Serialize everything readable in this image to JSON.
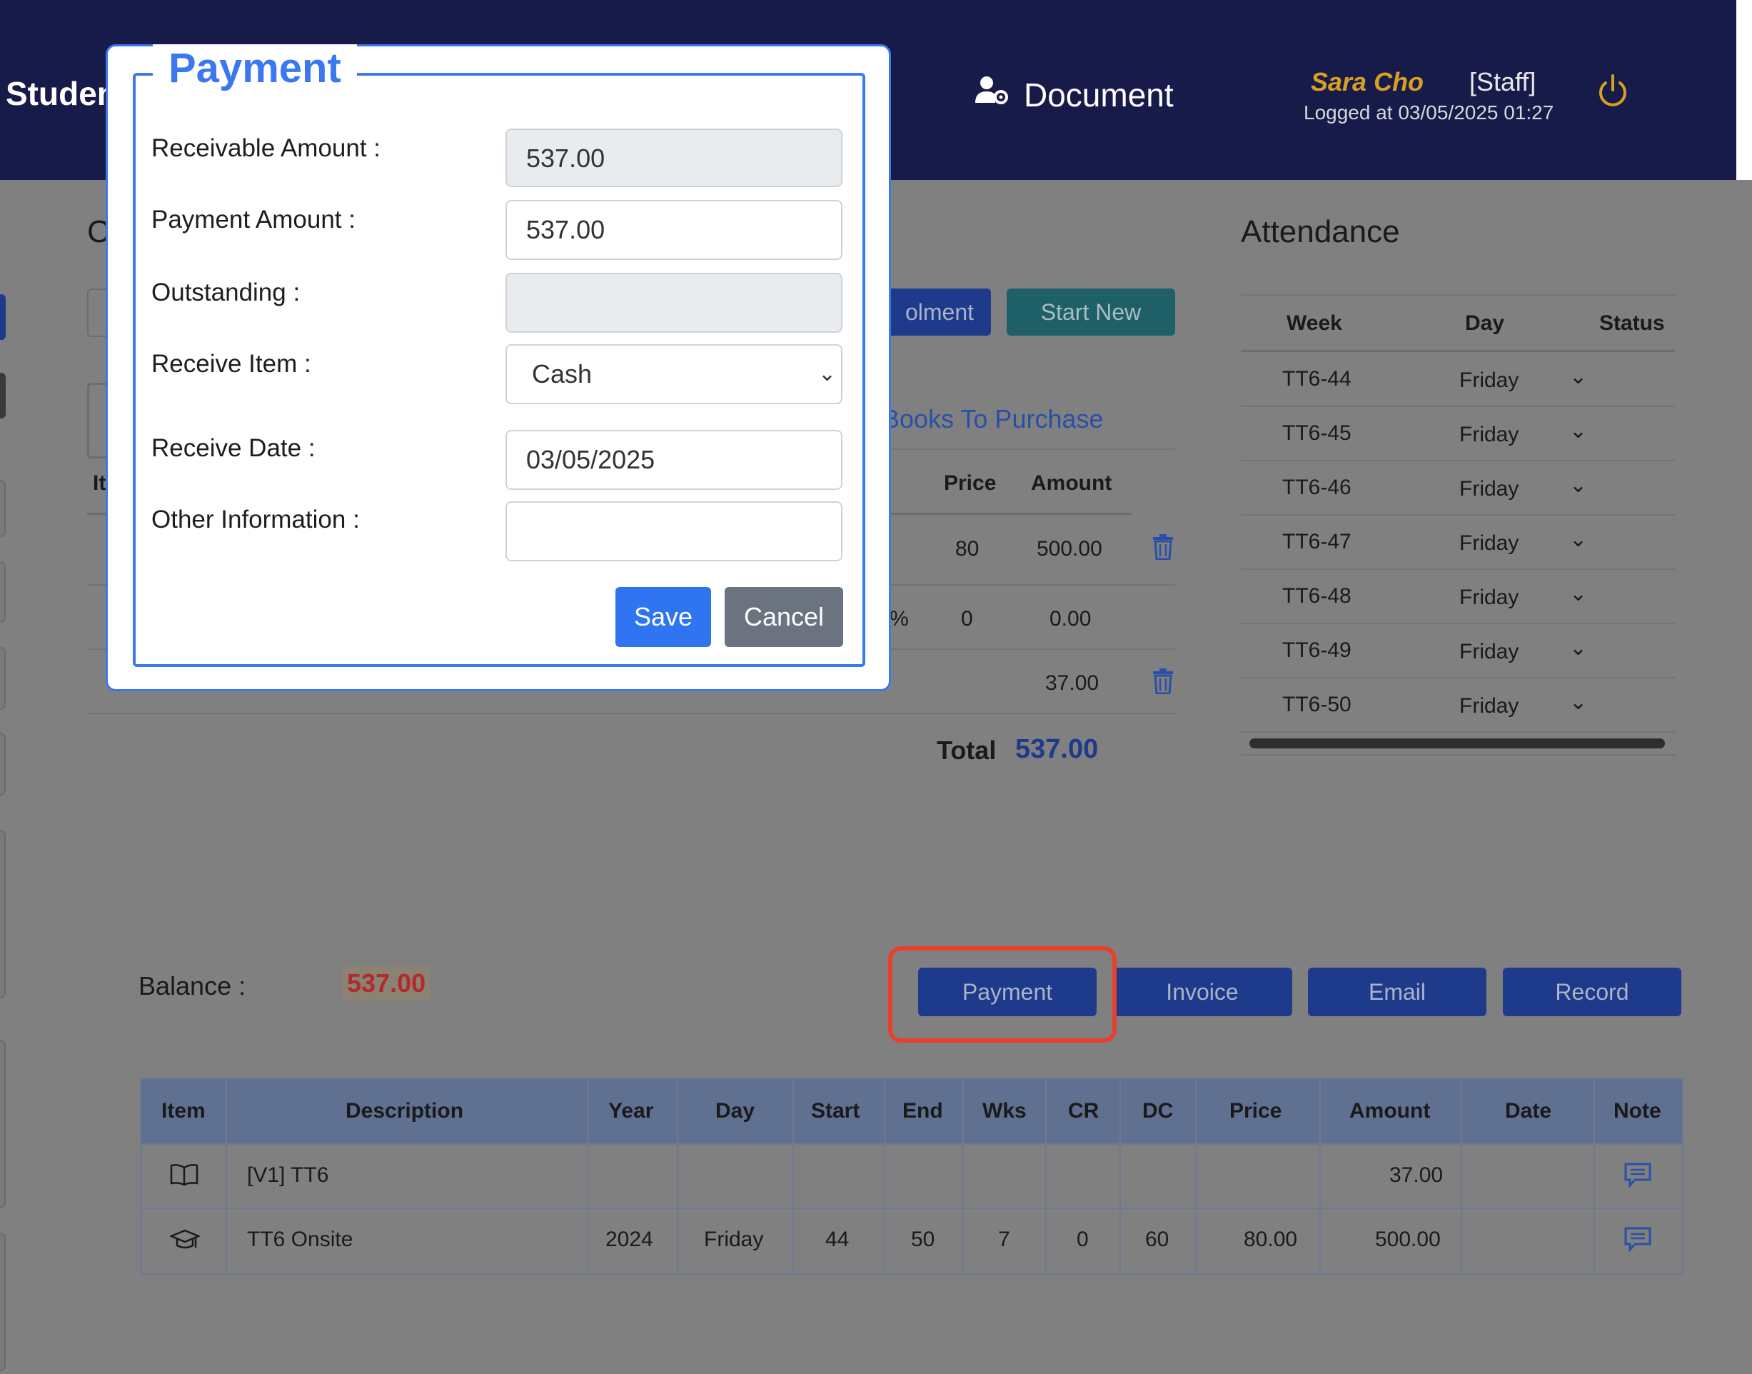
{
  "header": {
    "nav_left": "Studen",
    "nav_document": "Document",
    "user_name": "Sara Cho",
    "user_role": "[Staff]",
    "logged_at": "Logged at 03/05/2025 01:27"
  },
  "page": {
    "left_title_fragment": "C",
    "item_fragment": "It",
    "enrolment_fragment": "olment",
    "start_new": "Start New",
    "books_link": "Books To Purchase",
    "books_table": {
      "headers": [
        "Price",
        "Amount"
      ],
      "rows": [
        {
          "price": "80",
          "amount": "500.00"
        },
        {
          "pct": "%",
          "price": "0",
          "amount": "0.00"
        },
        {
          "price": "",
          "amount": "37.00"
        }
      ]
    },
    "total_label": "Total",
    "total_value": "537.00",
    "balance_label": "Balance :",
    "balance_value": "537.00"
  },
  "attendance": {
    "title": "Attendance",
    "headers": [
      "Week",
      "Day",
      "Status"
    ],
    "rows": [
      {
        "week": "TT6-44",
        "day": "Friday"
      },
      {
        "week": "TT6-45",
        "day": "Friday"
      },
      {
        "week": "TT6-46",
        "day": "Friday"
      },
      {
        "week": "TT6-47",
        "day": "Friday"
      },
      {
        "week": "TT6-48",
        "day": "Friday"
      },
      {
        "week": "TT6-49",
        "day": "Friday"
      },
      {
        "week": "TT6-50",
        "day": "Friday"
      }
    ]
  },
  "actions": {
    "payment": "Payment",
    "invoice": "Invoice",
    "email": "Email",
    "record": "Record"
  },
  "enrolment_table": {
    "headers": [
      "Item",
      "Description",
      "Year",
      "Day",
      "Start",
      "End",
      "Wks",
      "CR",
      "DC",
      "Price",
      "Amount",
      "Date",
      "Note"
    ],
    "rows": [
      {
        "icon": "book-icon",
        "description": "[V1] TT6",
        "year": "",
        "day": "",
        "start": "",
        "end": "",
        "wks": "",
        "cr": "",
        "dc": "",
        "price": "",
        "amount": "37.00",
        "date": ""
      },
      {
        "icon": "graduation-cap-icon",
        "description": "TT6 Onsite",
        "year": "2024",
        "day": "Friday",
        "start": "44",
        "end": "50",
        "wks": "7",
        "cr": "0",
        "dc": "60",
        "price": "80.00",
        "amount": "500.00",
        "date": ""
      }
    ]
  },
  "modal": {
    "title": "Payment",
    "receivable_label": "Receivable Amount :",
    "receivable_value": "537.00",
    "payment_label": "Payment Amount :",
    "payment_value": "537.00",
    "outstanding_label": "Outstanding :",
    "outstanding_value": "",
    "receive_item_label": "Receive Item :",
    "receive_item_value": "Cash",
    "receive_date_label": "Receive Date :",
    "receive_date_value": "03/05/2025",
    "other_info_label": "Other Information :",
    "other_info_value": "",
    "save": "Save",
    "cancel": "Cancel"
  },
  "colors": {
    "header_bg": "#161b4a",
    "accent_blue": "#3b78f0",
    "balance_red": "#b22a2a",
    "highlight": "#e8402a"
  }
}
